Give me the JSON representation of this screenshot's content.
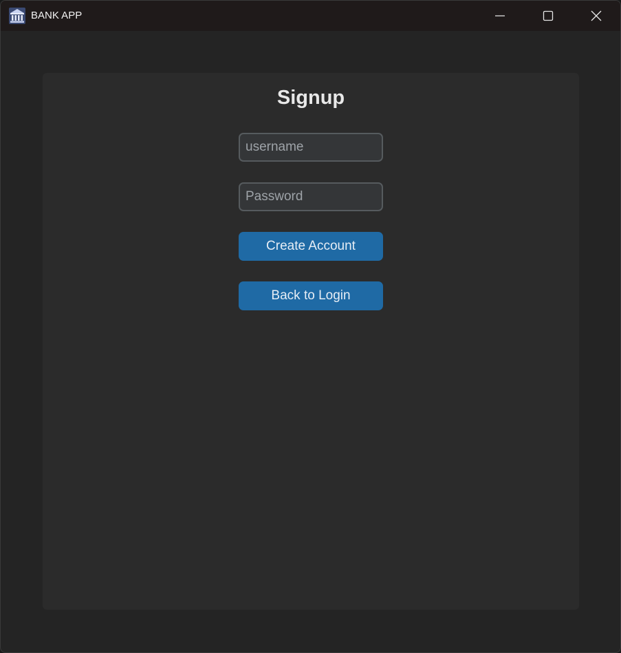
{
  "window": {
    "title": "BANK APP",
    "icon": "bank-icon",
    "controls": {
      "minimize_icon": "minimize-icon",
      "maximize_icon": "maximize-icon",
      "close_icon": "close-icon"
    }
  },
  "signup": {
    "heading": "Signup",
    "username_placeholder": "username",
    "username_value": "",
    "password_placeholder": "Password",
    "password_value": "",
    "create_account_label": "Create Account",
    "back_to_login_label": "Back to Login"
  },
  "colors": {
    "background": "#242424",
    "card": "#2b2b2b",
    "accent": "#1f6aa5",
    "field_border": "#565b5e",
    "field_bg": "#343638"
  }
}
